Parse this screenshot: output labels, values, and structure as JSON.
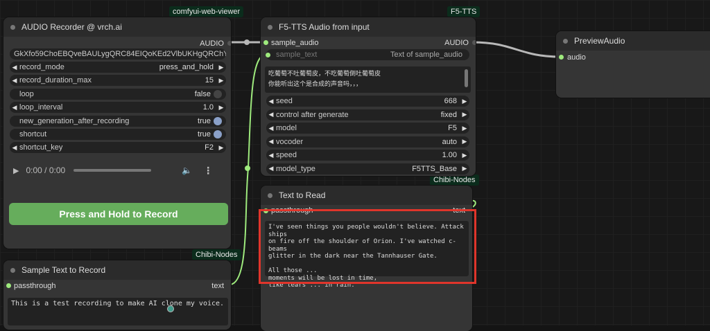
{
  "badges": {
    "viewer": "comfyui-web-viewer",
    "f5tts": "F5-TTS",
    "chibi_left": "Chibi-Nodes",
    "chibi_mid": "Chibi-Nodes"
  },
  "recorder": {
    "title": "AUDIO Recorder @ vrch.ai",
    "output": "AUDIO",
    "key_field": "GkXfo59ChoEBQveBAULygQRC84EIQoKEd2VlbUKHgQRChYE…",
    "widgets": [
      {
        "label": "record_mode",
        "value": "press_and_hold"
      },
      {
        "label": "record_duration_max",
        "value": "15"
      },
      {
        "label": "loop",
        "value": "false"
      },
      {
        "label": "loop_interval",
        "value": "1.0"
      },
      {
        "label": "new_generation_after_recording",
        "value": "true"
      },
      {
        "label": "shortcut",
        "value": "true"
      },
      {
        "label": "shortcut_key",
        "value": "F2"
      }
    ],
    "player_time": "0:00 / 0:00",
    "record_button": "Press and Hold to Record"
  },
  "sample_text": {
    "title": "Sample Text to Record",
    "input": "passthrough",
    "output": "text",
    "content": "This is a test recording to make AI clone my voice."
  },
  "f5": {
    "title": "F5-TTS Audio from input",
    "input_audio": "sample_audio",
    "input_text": "sample_text",
    "input_text_placeholder": "Text of sample_audio",
    "output": "AUDIO",
    "text_line1": "吃葡萄不吐葡萄皮，不吃葡萄倒吐葡萄皮",
    "text_line2": "你能听出这个是合成的声音吗，，，",
    "widgets": [
      {
        "label": "seed",
        "value": "668"
      },
      {
        "label": "control after generate",
        "value": "fixed"
      },
      {
        "label": "model",
        "value": "F5"
      },
      {
        "label": "vocoder",
        "value": "auto"
      },
      {
        "label": "speed",
        "value": "1.00"
      },
      {
        "label": "model_type",
        "value": "F5TTS_Base"
      }
    ]
  },
  "read": {
    "title": "Text to Read",
    "input": "passthrough",
    "output": "text",
    "lines": [
      "I've seen things you people wouldn't believe. Attack ships",
      "on fire off the shoulder of Orion. I've watched c-beams",
      "glitter in the dark near the Tannhauser Gate.",
      "",
      "All those ...",
      "moments will be lost in time,",
      "like tears ... in rain."
    ]
  },
  "preview": {
    "title": "PreviewAudio",
    "input": "audio"
  },
  "colors": {
    "link": "#9eea7d",
    "wire": "#b8b8b8",
    "highlight": "#e0352b",
    "button": "#66ad5c"
  }
}
